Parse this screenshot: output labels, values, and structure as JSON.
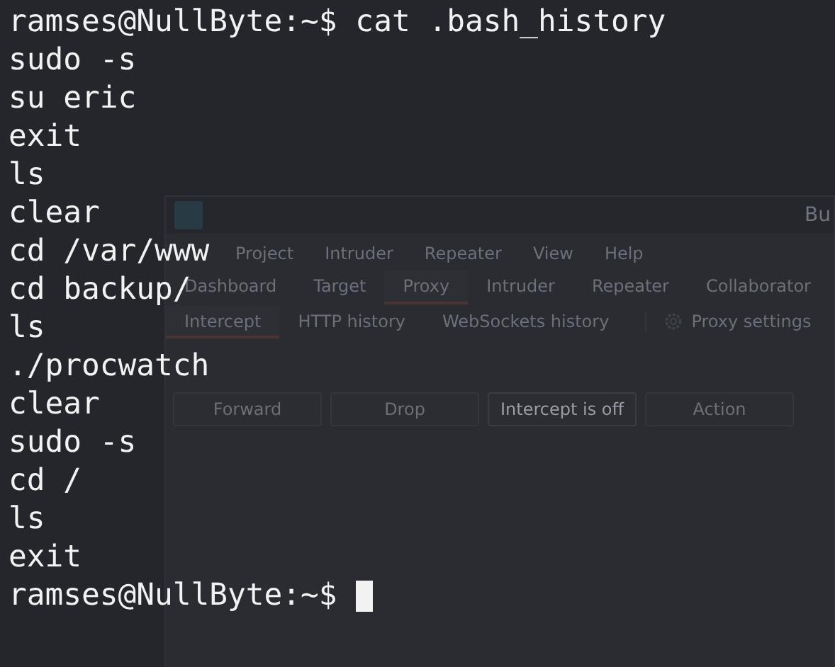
{
  "terminal": {
    "lines": [
      "ramses@NullByte:~$ cat .bash_history",
      "sudo -s",
      "su eric",
      "exit",
      "ls",
      "clear",
      "cd /var/www",
      "cd backup/",
      "ls",
      "./procwatch",
      "clear",
      "sudo -s",
      "cd /",
      "ls",
      "exit"
    ],
    "prompt": "ramses@NullByte:~$"
  },
  "background_window": {
    "title": "Bu",
    "menu": [
      "Project",
      "Intruder",
      "Repeater",
      "View",
      "Help"
    ],
    "tabs": [
      {
        "label": "Dashboard",
        "selected": false
      },
      {
        "label": "Target",
        "selected": false
      },
      {
        "label": "Proxy",
        "selected": true
      },
      {
        "label": "Intruder",
        "selected": false
      },
      {
        "label": "Repeater",
        "selected": false
      },
      {
        "label": "Collaborator",
        "selected": false
      }
    ],
    "subtabs": [
      {
        "label": "Intercept",
        "selected": true
      },
      {
        "label": "HTTP history",
        "selected": false
      },
      {
        "label": "WebSockets history",
        "selected": false
      }
    ],
    "settings": "Proxy settings",
    "buttons": [
      {
        "label": "Forward",
        "disabled": true
      },
      {
        "label": "Drop",
        "disabled": true
      },
      {
        "label": "Intercept is off",
        "disabled": false
      },
      {
        "label": "Action",
        "disabled": true
      }
    ]
  }
}
